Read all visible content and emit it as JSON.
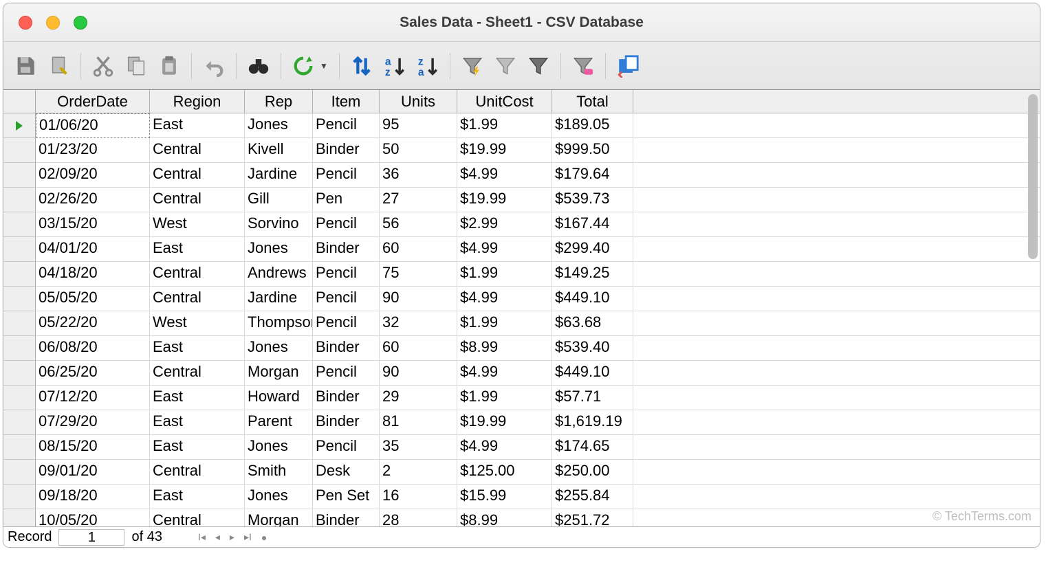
{
  "window": {
    "title": "Sales Data - Sheet1 - CSV Database"
  },
  "toolbar": {
    "save": "Save",
    "edit": "Edit",
    "cut": "Cut",
    "copy": "Copy",
    "paste": "Paste",
    "undo": "Undo",
    "find": "Find",
    "refresh": "Refresh",
    "sort": "Sort",
    "sort_asc": "Sort Ascending",
    "sort_desc": "Sort Descending",
    "autofilter": "AutoFilter",
    "apply_filter": "Apply Filter",
    "standard_filter": "Standard Filter",
    "reset_filter": "Reset Filter",
    "data_to_text": "Data to Text"
  },
  "columns": [
    "OrderDate",
    "Region",
    "Rep",
    "Item",
    "Units",
    "UnitCost",
    "Total"
  ],
  "rows": [
    {
      "OrderDate": "01/06/20",
      "Region": "East",
      "Rep": "Jones",
      "Item": "Pencil",
      "Units": "95",
      "UnitCost": "$1.99",
      "Total": "$189.05"
    },
    {
      "OrderDate": "01/23/20",
      "Region": "Central",
      "Rep": "Kivell",
      "Item": "Binder",
      "Units": "50",
      "UnitCost": "$19.99",
      "Total": "$999.50"
    },
    {
      "OrderDate": "02/09/20",
      "Region": "Central",
      "Rep": "Jardine",
      "Item": "Pencil",
      "Units": "36",
      "UnitCost": "$4.99",
      "Total": "$179.64"
    },
    {
      "OrderDate": "02/26/20",
      "Region": "Central",
      "Rep": "Gill",
      "Item": "Pen",
      "Units": "27",
      "UnitCost": "$19.99",
      "Total": "$539.73"
    },
    {
      "OrderDate": "03/15/20",
      "Region": "West",
      "Rep": "Sorvino",
      "Item": "Pencil",
      "Units": "56",
      "UnitCost": "$2.99",
      "Total": "$167.44"
    },
    {
      "OrderDate": "04/01/20",
      "Region": "East",
      "Rep": "Jones",
      "Item": "Binder",
      "Units": "60",
      "UnitCost": "$4.99",
      "Total": "$299.40"
    },
    {
      "OrderDate": "04/18/20",
      "Region": "Central",
      "Rep": "Andrews",
      "Item": "Pencil",
      "Units": "75",
      "UnitCost": "$1.99",
      "Total": "$149.25"
    },
    {
      "OrderDate": "05/05/20",
      "Region": "Central",
      "Rep": "Jardine",
      "Item": "Pencil",
      "Units": "90",
      "UnitCost": "$4.99",
      "Total": "$449.10"
    },
    {
      "OrderDate": "05/22/20",
      "Region": "West",
      "Rep": "Thompson",
      "Item": "Pencil",
      "Units": "32",
      "UnitCost": "$1.99",
      "Total": "$63.68"
    },
    {
      "OrderDate": "06/08/20",
      "Region": "East",
      "Rep": "Jones",
      "Item": "Binder",
      "Units": "60",
      "UnitCost": "$8.99",
      "Total": "$539.40"
    },
    {
      "OrderDate": "06/25/20",
      "Region": "Central",
      "Rep": "Morgan",
      "Item": "Pencil",
      "Units": "90",
      "UnitCost": "$4.99",
      "Total": "$449.10"
    },
    {
      "OrderDate": "07/12/20",
      "Region": "East",
      "Rep": "Howard",
      "Item": "Binder",
      "Units": "29",
      "UnitCost": "$1.99",
      "Total": "$57.71"
    },
    {
      "OrderDate": "07/29/20",
      "Region": "East",
      "Rep": "Parent",
      "Item": "Binder",
      "Units": "81",
      "UnitCost": "$19.99",
      "Total": "$1,619.19"
    },
    {
      "OrderDate": "08/15/20",
      "Region": "East",
      "Rep": "Jones",
      "Item": "Pencil",
      "Units": "35",
      "UnitCost": "$4.99",
      "Total": "$174.65"
    },
    {
      "OrderDate": "09/01/20",
      "Region": "Central",
      "Rep": "Smith",
      "Item": "Desk",
      "Units": "2",
      "UnitCost": "$125.00",
      "Total": "$250.00"
    },
    {
      "OrderDate": "09/18/20",
      "Region": "East",
      "Rep": "Jones",
      "Item": "Pen Set",
      "Units": "16",
      "UnitCost": "$15.99",
      "Total": "$255.84"
    },
    {
      "OrderDate": "10/05/20",
      "Region": "Central",
      "Rep": "Morgan",
      "Item": "Binder",
      "Units": "28",
      "UnitCost": "$8.99",
      "Total": "$251.72"
    }
  ],
  "status": {
    "record_label": "Record",
    "current": "1",
    "of_label": "of 43"
  },
  "watermark": "© TechTerms.com"
}
